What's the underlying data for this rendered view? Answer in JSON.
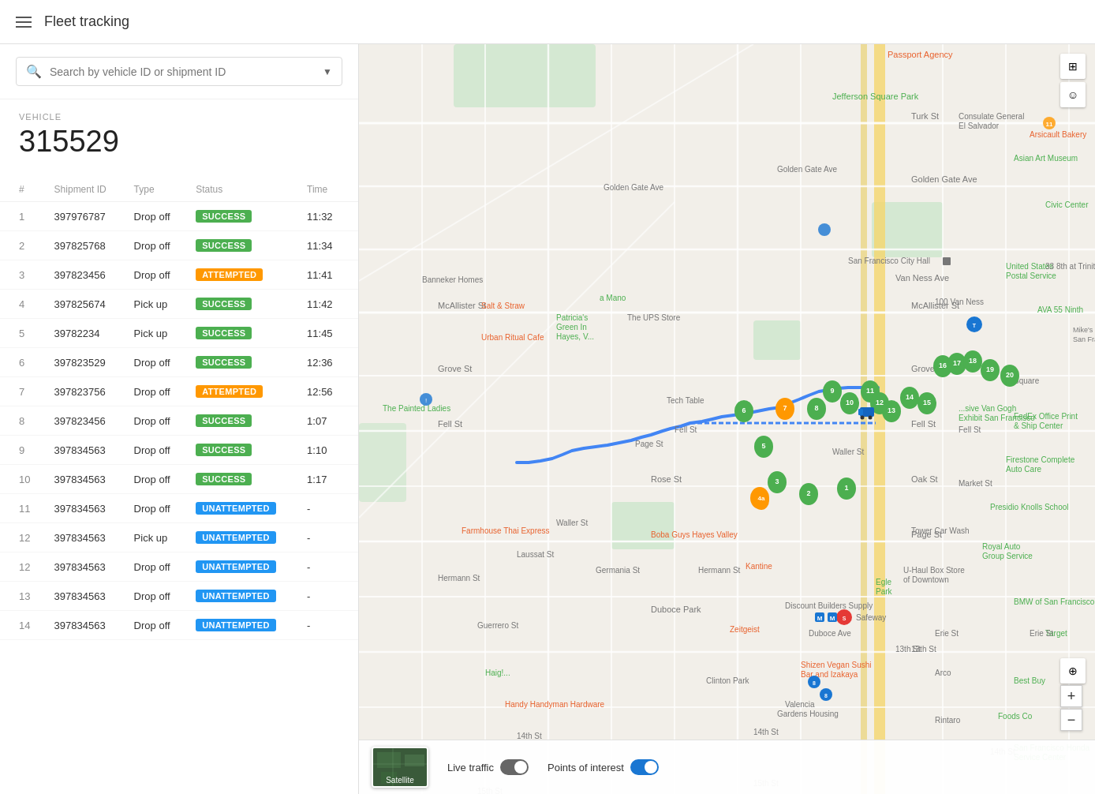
{
  "header": {
    "title": "Fleet tracking",
    "menu_icon": "hamburger-icon"
  },
  "search": {
    "placeholder": "Search by vehicle ID or shipment ID"
  },
  "vehicle": {
    "label": "VEHICLE",
    "id": "315529"
  },
  "table": {
    "columns": [
      "#",
      "Shipment ID",
      "Type",
      "Status",
      "Time"
    ],
    "rows": [
      {
        "num": 1,
        "shipment_id": "397976787",
        "type": "Drop off",
        "status": "SUCCESS",
        "time": "11:32"
      },
      {
        "num": 2,
        "shipment_id": "397825768",
        "type": "Drop off",
        "status": "SUCCESS",
        "time": "11:34"
      },
      {
        "num": 3,
        "shipment_id": "397823456",
        "type": "Drop off",
        "status": "ATTEMPTED",
        "time": "11:41"
      },
      {
        "num": 4,
        "shipment_id": "397825674",
        "type": "Pick up",
        "status": "SUCCESS",
        "time": "11:42"
      },
      {
        "num": 5,
        "shipment_id": "39782234",
        "type": "Pick up",
        "status": "SUCCESS",
        "time": "11:45"
      },
      {
        "num": 6,
        "shipment_id": "397823529",
        "type": "Drop off",
        "status": "SUCCESS",
        "time": "12:36"
      },
      {
        "num": 7,
        "shipment_id": "397823756",
        "type": "Drop off",
        "status": "ATTEMPTED",
        "time": "12:56"
      },
      {
        "num": 8,
        "shipment_id": "397823456",
        "type": "Drop off",
        "status": "SUCCESS",
        "time": "1:07"
      },
      {
        "num": 9,
        "shipment_id": "397834563",
        "type": "Drop off",
        "status": "SUCCESS",
        "time": "1:10"
      },
      {
        "num": 10,
        "shipment_id": "397834563",
        "type": "Drop off",
        "status": "SUCCESS",
        "time": "1:17"
      },
      {
        "num": 11,
        "shipment_id": "397834563",
        "type": "Drop off",
        "status": "UNATTEMPTED",
        "time": "-"
      },
      {
        "num": 12,
        "shipment_id": "397834563",
        "type": "Pick up",
        "status": "UNATTEMPTED",
        "time": "-"
      },
      {
        "num": 12,
        "shipment_id": "397834563",
        "type": "Drop off",
        "status": "UNATTEMPTED",
        "time": "-"
      },
      {
        "num": 13,
        "shipment_id": "397834563",
        "type": "Drop off",
        "status": "UNATTEMPTED",
        "time": "-"
      },
      {
        "num": 14,
        "shipment_id": "397834563",
        "type": "Drop off",
        "status": "UNATTEMPTED",
        "time": "-"
      }
    ]
  },
  "map": {
    "live_traffic_label": "Live traffic",
    "points_of_interest_label": "Points of interest",
    "satellite_label": "Satellite",
    "zoom_in": "+",
    "zoom_out": "−"
  },
  "colors": {
    "success": "#4caf50",
    "attempted": "#ff9800",
    "unattempted": "#2196f3",
    "route": "#4285f4"
  }
}
